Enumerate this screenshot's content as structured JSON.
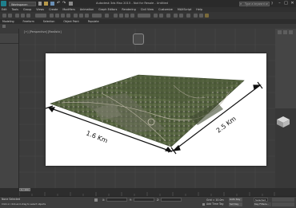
{
  "window": {
    "workspace_label": "Workspace: Default",
    "title": "Autodesk 3ds Max 2015 - Not for Resale - Untitled",
    "search_placeholder": "Type a keyword or phrase",
    "controls": [
      "–",
      "□",
      "✕"
    ]
  },
  "menu": {
    "items": [
      "Edit",
      "Tools",
      "Group",
      "Views",
      "Create",
      "Modifiers",
      "Animation",
      "Graph Editors",
      "Rendering",
      "Civil View",
      "Customize",
      "MAXScript",
      "Help"
    ]
  },
  "ribbon": {
    "tabs": [
      "Modeling",
      "Freeform",
      "Selection",
      "Object Paint",
      "Populate"
    ]
  },
  "viewport": {
    "label": "[+] [Perspective] [Realistic]"
  },
  "map": {
    "width_label": "1.6 Km",
    "length_label": "2.5 Km"
  },
  "statusbar": {
    "selected_label": "None Selected",
    "prompt": "Click or click-and-drag to select objects",
    "coord_x_label": "X:",
    "coord_y_label": "Y:",
    "coord_z_label": "Z:",
    "grid_label": "Grid = 10.0m",
    "auto_key_label": "Auto Key",
    "set_key_label": "Set Key",
    "selected_dropdown": "Selected",
    "key_filters_label": "Key Filters...",
    "add_time_tag": "Add Time Tag",
    "frame_counter": "0 / 100"
  },
  "colors": {
    "sheet": "#ffffff",
    "viewport": "#3c3c3c",
    "terrain_green": "#4d5b3a"
  }
}
